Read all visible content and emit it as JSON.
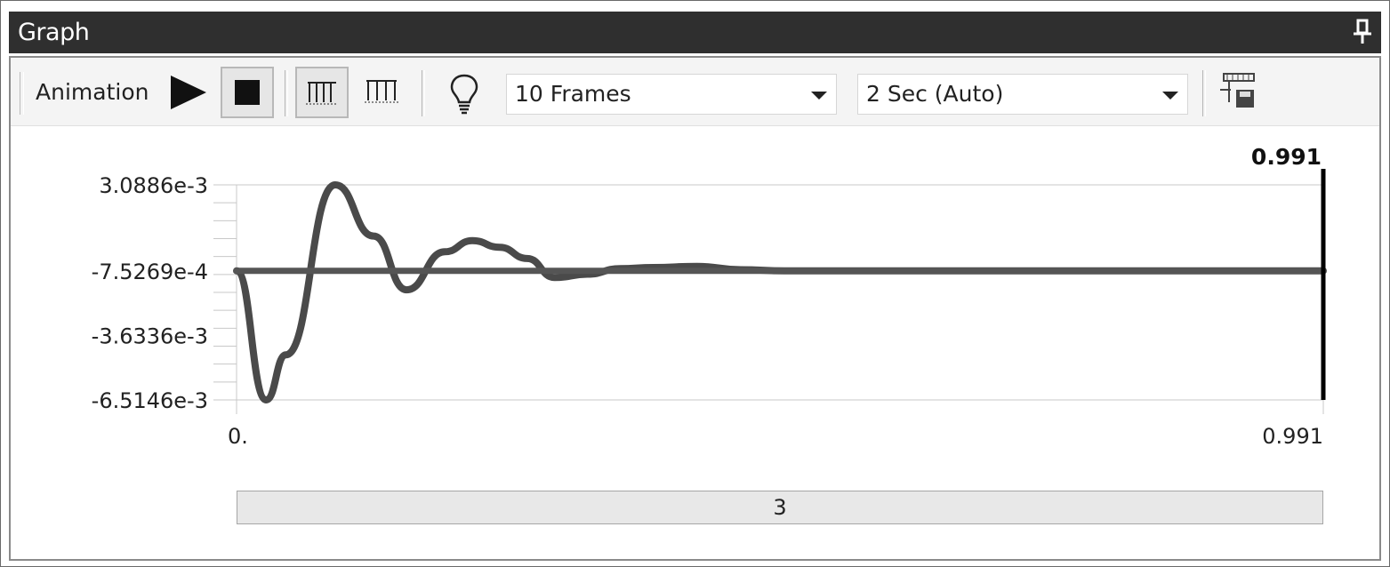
{
  "window": {
    "title": "Graph"
  },
  "toolbar": {
    "label": "Animation",
    "frames_value": "10 Frames",
    "duration_value": "2 Sec (Auto)"
  },
  "chart_data": {
    "type": "line",
    "ylabels": [
      "3.0886e-3",
      "-7.5269e-4",
      "-3.6336e-3",
      "-6.5146e-3"
    ],
    "y_ticks": [
      0.0030886,
      -0.00075269,
      -0.0036336,
      -0.0065146
    ],
    "ylim": [
      -0.0065146,
      0.0030886
    ],
    "xlim": [
      0,
      0.991
    ],
    "xlabels": [
      "0.",
      "0.991"
    ],
    "current_time_label": "0.991",
    "series": [
      {
        "values_description": "damped oscillation",
        "x": [
          0,
          0.027,
          0.045,
          0.09,
          0.125,
          0.155,
          0.19,
          0.215,
          0.24,
          0.265,
          0.29,
          0.32,
          0.35,
          0.38,
          0.42,
          0.46,
          0.5,
          0.55,
          0.6,
          0.7,
          0.8,
          0.9,
          0.991
        ],
        "y": [
          -0.00075,
          -0.0065146,
          -0.0045,
          0.0030886,
          0.0008,
          -0.0016,
          0.0001,
          0.0006,
          0.0003,
          -0.0002,
          -0.00105,
          -0.0009,
          -0.00065,
          -0.0006,
          -0.00055,
          -0.0007,
          -0.00075,
          -0.00075,
          -0.00075,
          -0.00075,
          -0.00075,
          -0.00075,
          -0.00075
        ]
      },
      {
        "values_description": "reference line",
        "x": [
          0,
          0.991
        ],
        "y": [
          -0.00075269,
          -0.00075269
        ]
      }
    ],
    "grid": false
  },
  "scrubber": {
    "value": "3"
  }
}
